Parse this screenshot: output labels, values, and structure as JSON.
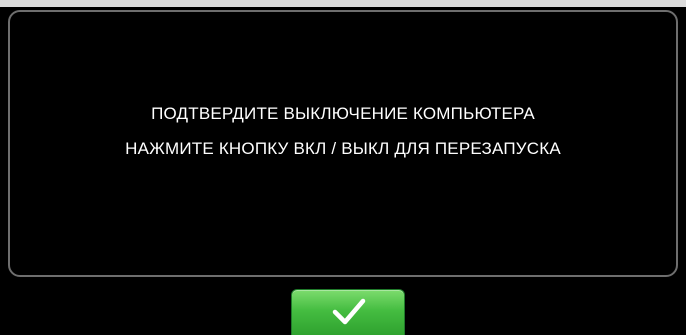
{
  "dialog": {
    "line1": "ПОДТВЕРДИТЕ ВЫКЛЮЧЕНИЕ КОМПЬЮТЕРА",
    "line2": "НАЖМИТЕ КНОПКУ ВКЛ / ВЫКЛ ДЛЯ ПЕРЕЗАПУСКА"
  },
  "confirm_button": {
    "icon": "checkmark-icon",
    "color": "#45bd41"
  },
  "colors": {
    "background": "#000000",
    "text": "#ffffff",
    "border": "#6e6e6e"
  }
}
